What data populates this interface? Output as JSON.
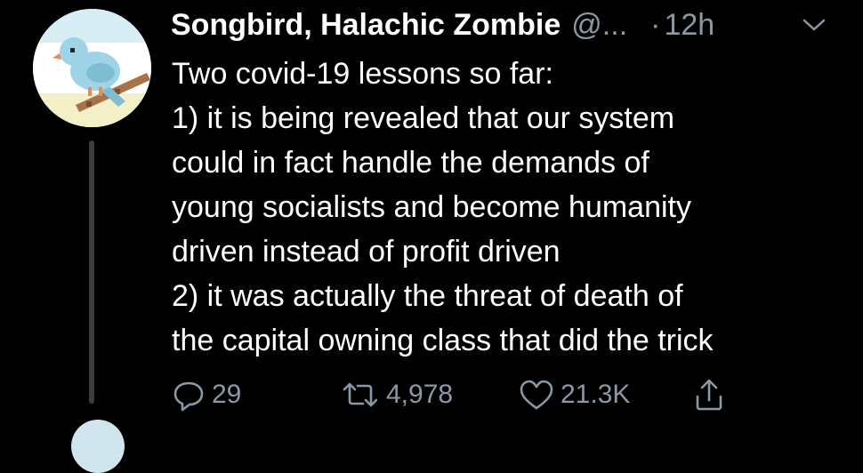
{
  "tweet": {
    "display_name": "Songbird, Halachic Zombie",
    "handle": "@...",
    "separator": "·",
    "time": "12h",
    "text_lines": [
      "Two covid-19 lessons so far:",
      "1) it is being revealed that our system",
      "could in fact handle the demands of",
      "young socialists and become humanity",
      "driven instead of profit driven",
      "2) it was actually the threat of death of",
      "the capital owning class that did the trick"
    ],
    "actions": {
      "replies": "29",
      "retweets": "4,978",
      "likes": "21.3K"
    }
  },
  "icons": {
    "more": "chevron-down-icon",
    "reply": "reply-icon",
    "retweet": "retweet-icon",
    "like": "heart-icon",
    "share": "share-icon",
    "avatar": "pixel-bluebird-avatar"
  },
  "colors": {
    "background": "#000000",
    "text": "#ffffff",
    "secondary": "#8b98a5",
    "thread_line": "#3a3d40",
    "bird": "#9fd4e6"
  }
}
